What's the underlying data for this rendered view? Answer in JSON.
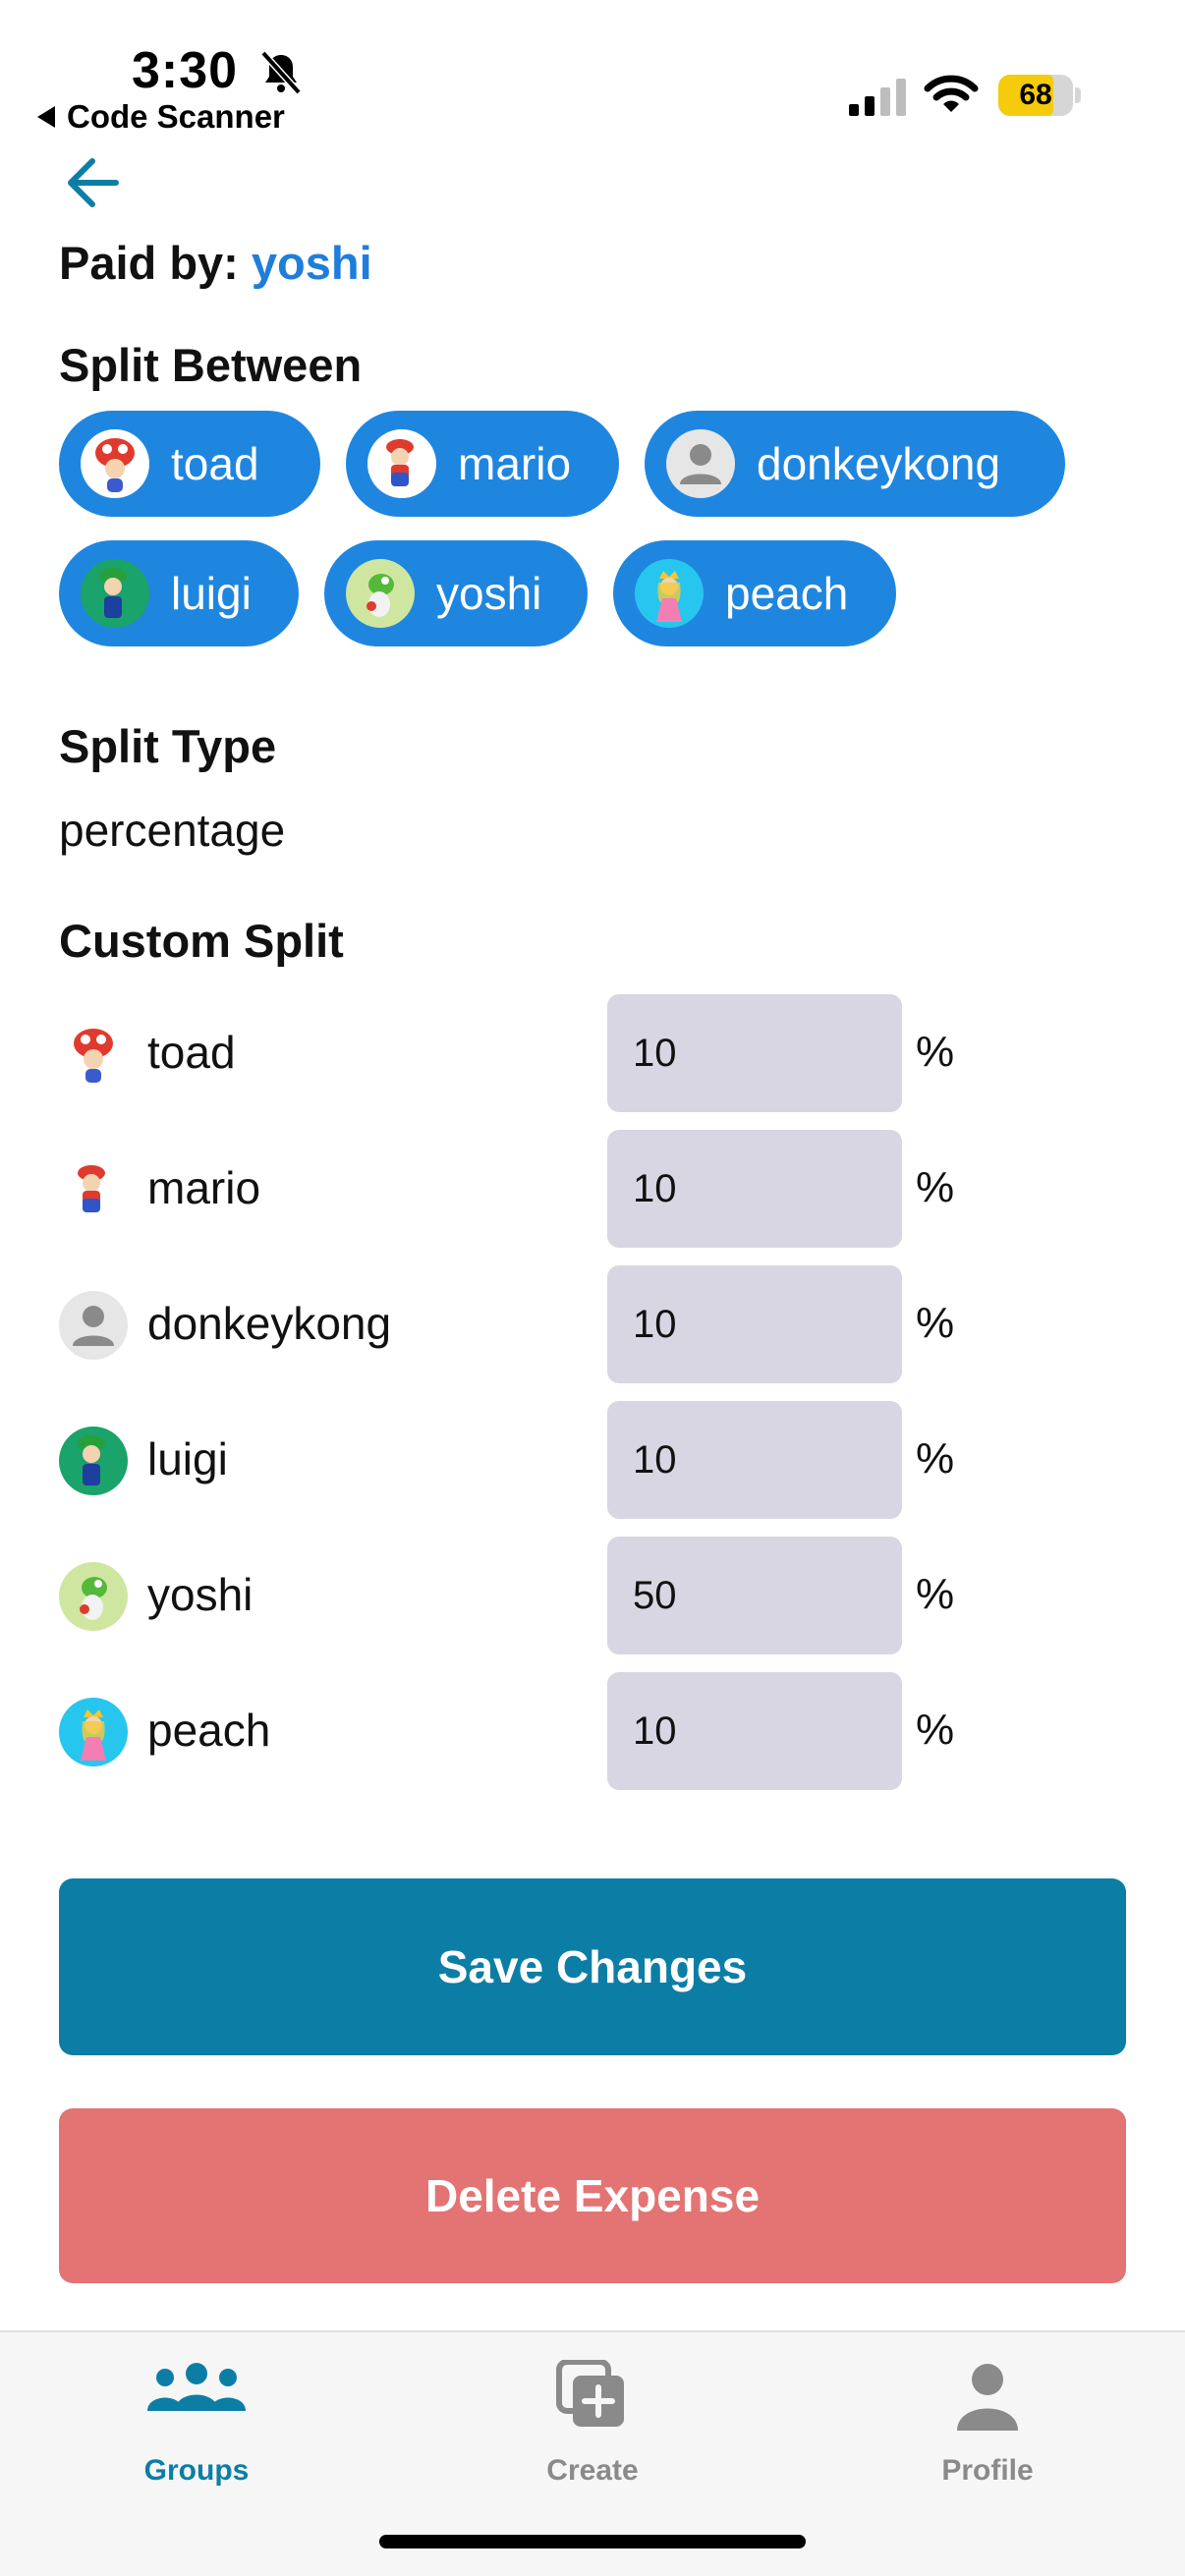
{
  "status_bar": {
    "time": "3:30",
    "back_app": "Code Scanner",
    "battery": "68"
  },
  "expense": {
    "paid_by_label": "Paid by:",
    "paid_by_name": "yoshi",
    "split_between_title": "Split Between",
    "participants": [
      {
        "name": "toad",
        "avatar": "toad-avatar"
      },
      {
        "name": "mario",
        "avatar": "mario-avatar"
      },
      {
        "name": "donkeykong",
        "avatar": "default-person-avatar"
      },
      {
        "name": "luigi",
        "avatar": "luigi-avatar"
      },
      {
        "name": "yoshi",
        "avatar": "yoshi-avatar"
      },
      {
        "name": "peach",
        "avatar": "peach-avatar"
      }
    ],
    "split_type_title": "Split Type",
    "split_type_value": "percentage",
    "custom_split_title": "Custom Split",
    "custom_split": [
      {
        "name": "toad",
        "value": "10",
        "unit": "%"
      },
      {
        "name": "mario",
        "value": "10",
        "unit": "%"
      },
      {
        "name": "donkeykong",
        "value": "10",
        "unit": "%"
      },
      {
        "name": "luigi",
        "value": "10",
        "unit": "%"
      },
      {
        "name": "yoshi",
        "value": "50",
        "unit": "%"
      },
      {
        "name": "peach",
        "value": "10",
        "unit": "%"
      }
    ],
    "save_label": "Save Changes",
    "delete_label": "Delete Expense"
  },
  "tabbar": {
    "groups_label": "Groups",
    "create_label": "Create",
    "profile_label": "Profile"
  },
  "colors": {
    "accent_teal": "#0c7ea6",
    "chip_blue": "#1f86e0",
    "payer_blue": "#1f7ddb",
    "delete_red": "#e47373",
    "input_bg": "#d9d6e3"
  }
}
